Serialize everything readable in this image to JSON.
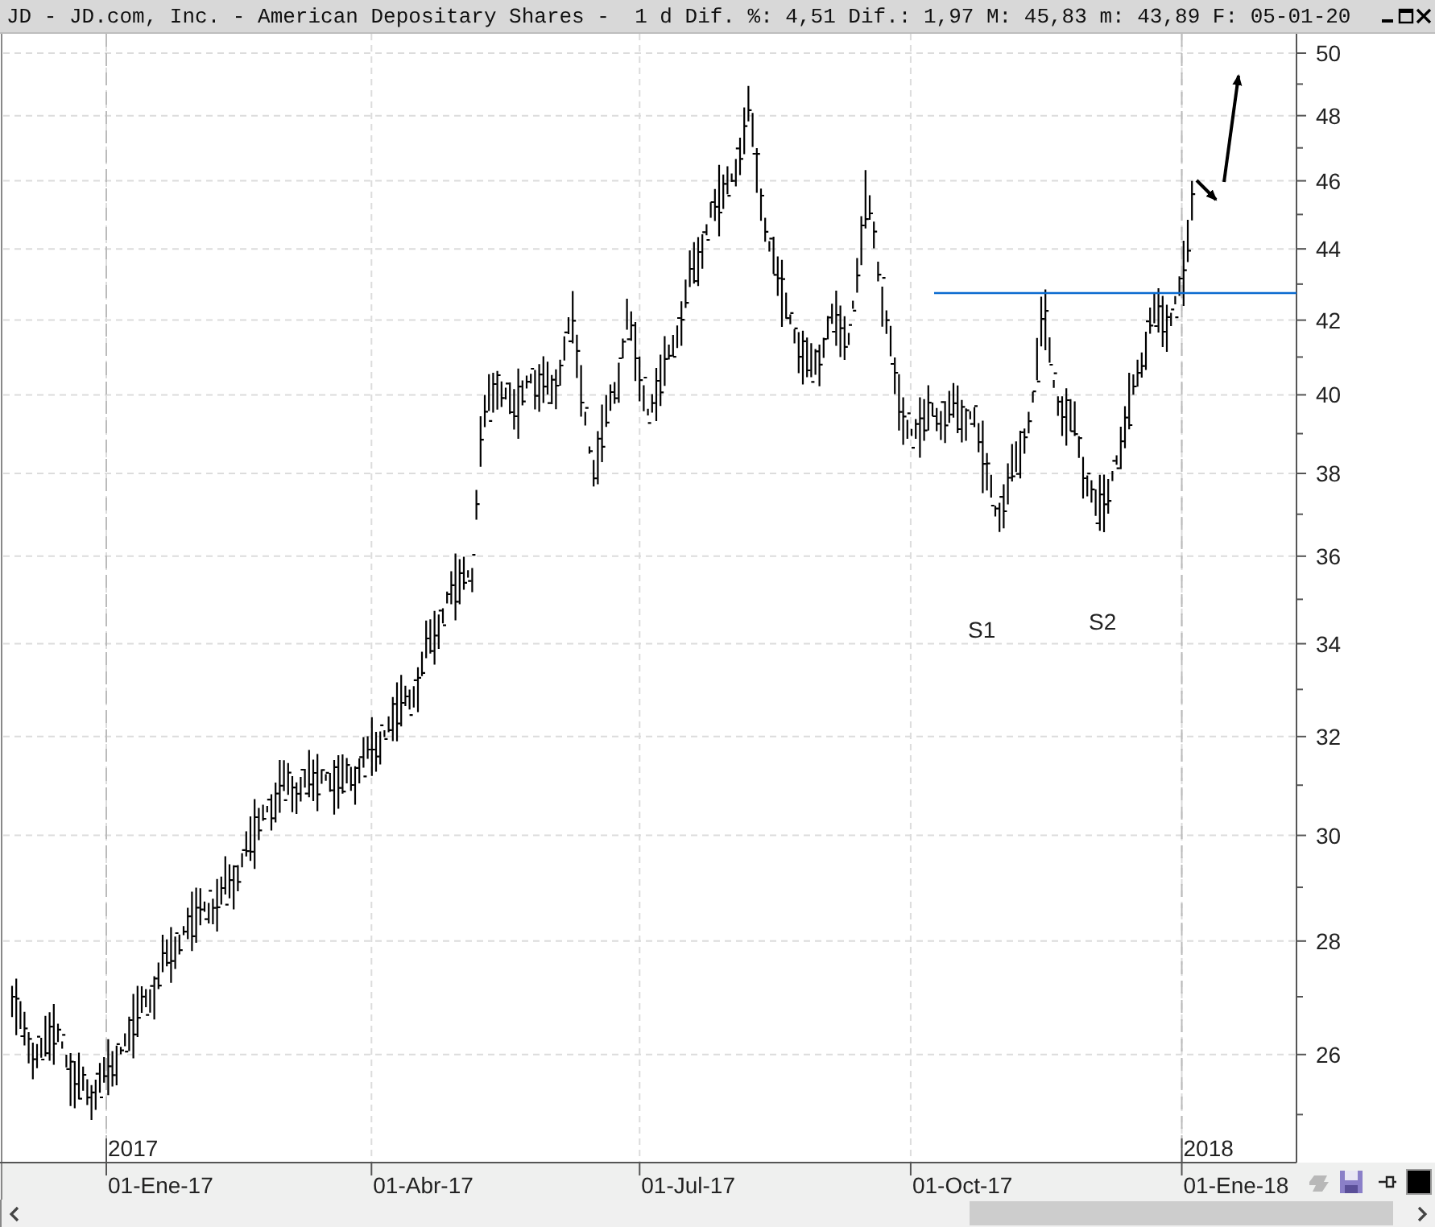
{
  "window": {
    "title": "JD - JD.com, Inc. - American Depositary Shares -  1 d Dif. %: 4,51 Dif.: 1,97 M: 45,83 m: 43,89 F: 05-01-20"
  },
  "chart": {
    "y_axis_labels": [
      "50",
      "48",
      "46",
      "44",
      "42",
      "40",
      "38",
      "36",
      "34",
      "32",
      "30",
      "28",
      "26"
    ],
    "x_axis_labels": [
      "01-Ene-17",
      "01-Abr-17",
      "01-Jul-17",
      "01-Oct-17",
      "01-Ene-18"
    ],
    "year_labels": [
      "2017",
      "2018"
    ],
    "annotations": [
      "S1",
      "S2"
    ]
  }
}
